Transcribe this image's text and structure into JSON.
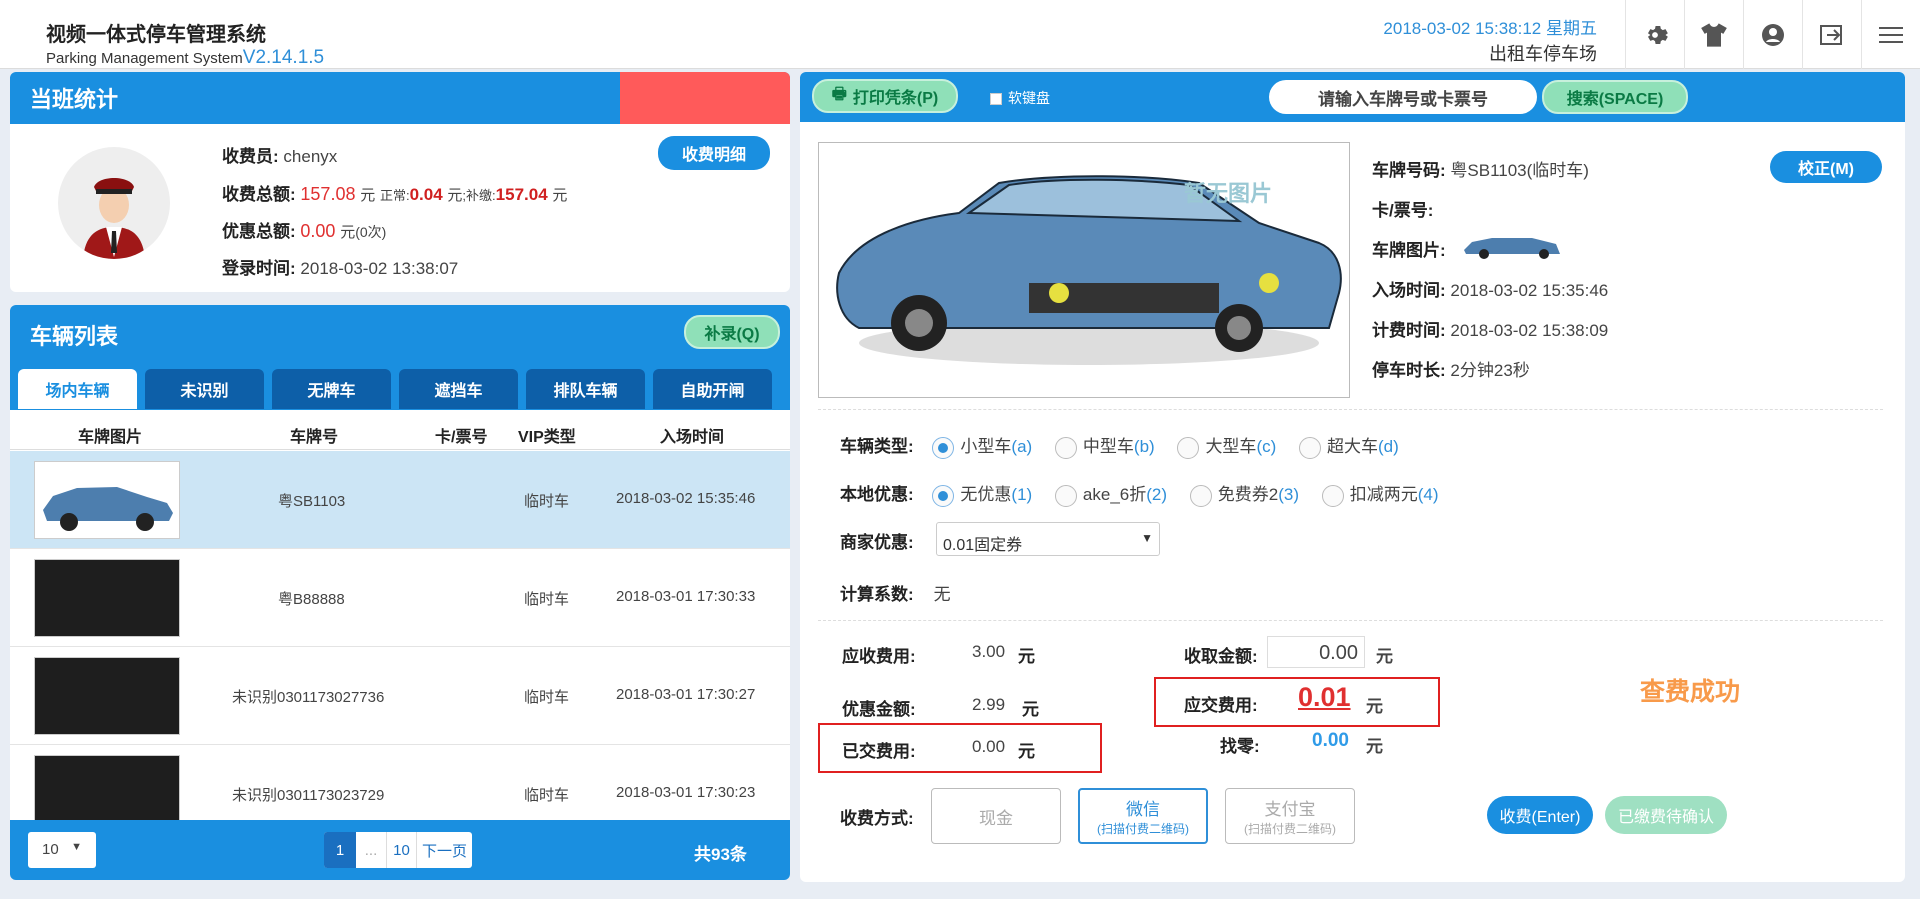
{
  "app": {
    "title": "视频一体式停车管理系统",
    "subtitle": "Parking Management System",
    "version": "V2.14.1.5",
    "datetime": "2018-03-02 15:38:12 星期五",
    "lot_name": "出租车停车场"
  },
  "header_icons": [
    "gear-icon",
    "shirt-icon",
    "user-icon",
    "logout-icon",
    "menu-icon"
  ],
  "shift": {
    "title": "当班统计",
    "detail_btn": "收费明细",
    "collector_label": "收费员:",
    "collector": "chenyx",
    "total_label": "收费总额:",
    "total": "157.08",
    "yuan": "元",
    "normal_label": "正常:",
    "normal": "0.04",
    "yuan2": "元",
    "supp_label": ";补缴:",
    "supp": "157.04",
    "yuan3": "元",
    "discount_label": "优惠总额:",
    "discount": "0.00",
    "yuan4": "元",
    "discount_count": "(0次)",
    "login_label": "登录时间:",
    "login": "2018-03-02 13:38:07"
  },
  "vehicles": {
    "title": "车辆列表",
    "supplement_btn": "补录(Q)",
    "tabs": [
      "场内车辆",
      "未识别",
      "无牌车",
      "遮挡车",
      "排队车辆",
      "自助开闸"
    ],
    "columns": [
      "车牌图片",
      "车牌号",
      "卡/票号",
      "VIP类型",
      "入场时间"
    ],
    "rows": [
      {
        "plate": "粤SB1103",
        "card": "",
        "vip": "临时车",
        "time": "2018-03-02 15:35:46"
      },
      {
        "plate": "粤B88888",
        "card": "",
        "vip": "临时车",
        "time": "2018-03-01 17:30:33"
      },
      {
        "plate": "未识别0301173027736",
        "card": "",
        "vip": "临时车",
        "time": "2018-03-01 17:30:27"
      },
      {
        "plate": "未识别0301173023729",
        "card": "",
        "vip": "临时车",
        "time": "2018-03-01 17:30:23"
      }
    ],
    "page_size": "10",
    "pages": [
      "1",
      "...",
      "10",
      "下一页"
    ],
    "total": "共93条"
  },
  "toolbar": {
    "print_btn": "打印凭条(P)",
    "softkb": "软键盘",
    "search_placeholder": "请输入车牌号或卡票号",
    "search_btn": "搜索(SPACE)"
  },
  "detail": {
    "no_image": "暂无图片",
    "plate_label": "车牌号码:",
    "plate": "粤SB1103(临时车)",
    "correct_btn": "校正(M)",
    "card_label": "卡/票号:",
    "card": "",
    "plate_img_label": "车牌图片:",
    "entry_label": "入场时间:",
    "entry": "2018-03-02 15:35:46",
    "charge_label": "计费时间:",
    "charge": "2018-03-02 15:38:09",
    "dur_label": "停车时长:",
    "dur": "2分钟23秒",
    "vtype_label": "车辆类型:",
    "vtypes": [
      {
        "t": "小型车",
        "k": "(a)"
      },
      {
        "t": "中型车",
        "k": "(b)"
      },
      {
        "t": "大型车",
        "k": "(c)"
      },
      {
        "t": "超大车",
        "k": "(d)"
      }
    ],
    "local_label": "本地优惠:",
    "locals": [
      {
        "t": "无优惠",
        "k": "(1)"
      },
      {
        "t": "ake_6折",
        "k": "(2)"
      },
      {
        "t": "免费券2",
        "k": "(3)"
      },
      {
        "t": "扣减两元",
        "k": "(4)"
      }
    ],
    "merchant_label": "商家优惠:",
    "merchant": "0.01固定券",
    "coef_label": "计算系数:",
    "coef": "无",
    "receivable_label": "应收费用:",
    "receivable": "3.00",
    "disc_label": "优惠金额:",
    "disc": "2.99",
    "paid_label": "已交费用:",
    "paid": "0.00",
    "yuan": "元",
    "collect_label": "收取金额:",
    "collect": "0.00",
    "due_label": "应交费用:",
    "due": "0.01",
    "change_label": "找零:",
    "change": "0.00",
    "status": "查费成功",
    "pay_label": "收费方式:",
    "pay_cash": "现金",
    "pay_wx": "微信",
    "pay_wx_sub": "(扫描付费二维码)",
    "pay_ali": "支付宝",
    "pay_ali_sub": "(扫描付费二维码)",
    "charge_btn": "收费(Enter)",
    "pending_btn": "已缴费待确认"
  }
}
